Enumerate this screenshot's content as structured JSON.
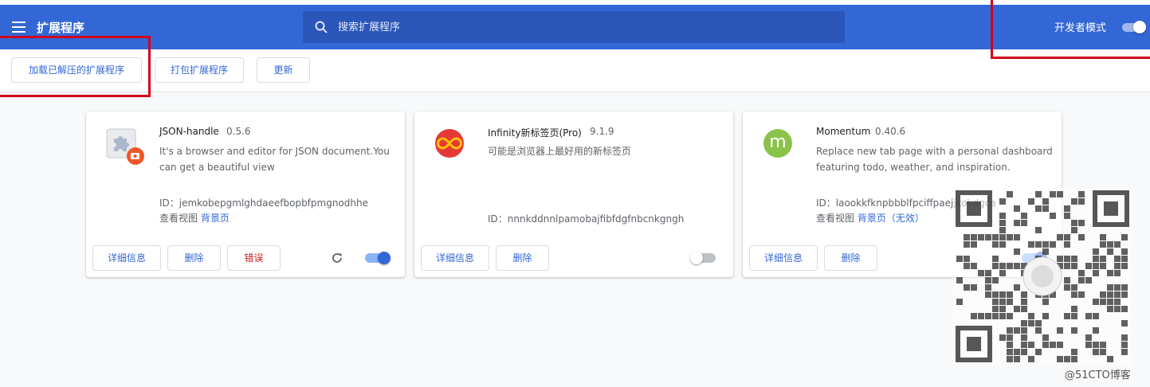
{
  "header": {
    "title": "扩展程序",
    "search_placeholder": "搜索扩展程序",
    "dev_mode_label": "开发者模式"
  },
  "toolbar": {
    "load_unpacked": "加载已解压的扩展程序",
    "pack_extension": "打包扩展程序",
    "update": "更新"
  },
  "extensions": [
    {
      "name": "JSON-handle",
      "version": "0.5.6",
      "description": "It's a browser and editor for JSON document.You can get a beautiful view",
      "id_line": "ID：jemkobepgmlghdaeefbopbfpmgnodhhe",
      "views_label": "查看视图",
      "background_link": "背景页",
      "details_label": "详细信息",
      "remove_label": "删除",
      "error_label": "错误",
      "enabled": true
    },
    {
      "name": "Infinity新标签页(Pro)",
      "version": "9.1.9",
      "description": "可能是浏览器上最好用的新标签页",
      "id_line": "ID：nnnkddnnlpamobajfibfdgfnbcnkgngh",
      "details_label": "详细信息",
      "remove_label": "删除",
      "enabled": false
    },
    {
      "name": "Momentum",
      "version": "0.40.6",
      "description": "Replace new tab page with a personal dashboard featuring todo, weather, and inspiration.",
      "id_line": "ID：laookkfknpbbblfpciffpaejjkokdgca",
      "views_label": "查看视图",
      "background_link": "背景页",
      "inactive_label": "（无效）",
      "details_label": "详细信息",
      "remove_label": "删除",
      "enabled": true,
      "icon_letter": "m"
    }
  ],
  "watermark": "@51CTO博客",
  "colors": {
    "header_bg": "#3367d6",
    "accent": "#3367d6",
    "error": "#c5221f",
    "highlight_box": "#d0021b"
  }
}
